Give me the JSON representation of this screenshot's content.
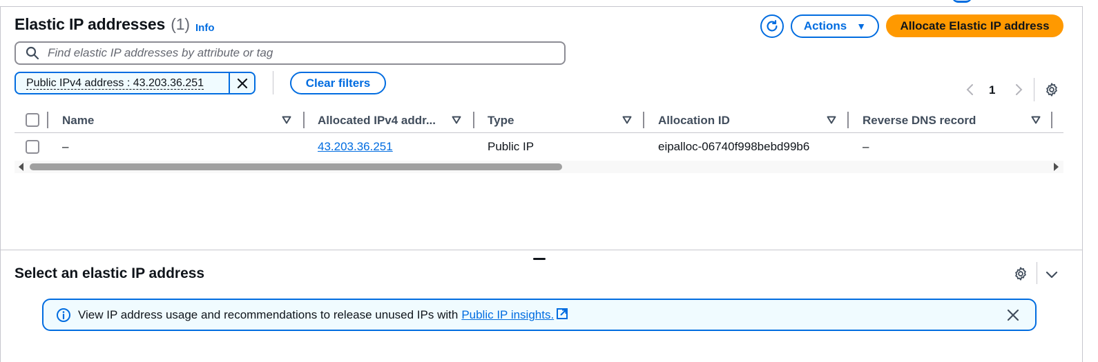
{
  "header": {
    "title": "Elastic IP addresses",
    "count": "(1)",
    "info_label": "Info",
    "actions_label": "Actions",
    "allocate_label": "Allocate Elastic IP address"
  },
  "search": {
    "placeholder": "Find elastic IP addresses by attribute or tag"
  },
  "filter": {
    "token_label": "Public IPv4 address : 43.203.36.251",
    "clear_label": "Clear filters"
  },
  "pagination": {
    "current_page": "1"
  },
  "table": {
    "columns": [
      "Name",
      "Allocated IPv4 addr...",
      "Type",
      "Allocation ID",
      "Reverse DNS record"
    ],
    "rows": [
      {
        "name": "–",
        "ipv4": "43.203.36.251",
        "type": "Public IP",
        "allocation_id": "eipalloc-06740f998bebd99b6",
        "reverse_dns": "–"
      }
    ]
  },
  "split_panel": {
    "title": "Select an elastic IP address"
  },
  "alert": {
    "text": "View IP address usage and recommendations to release unused IPs with",
    "link_label": "Public IP insights."
  },
  "colors": {
    "accent": "#006ce0",
    "primary_button": "#ff9900",
    "alert_bg": "#f0fbff"
  }
}
